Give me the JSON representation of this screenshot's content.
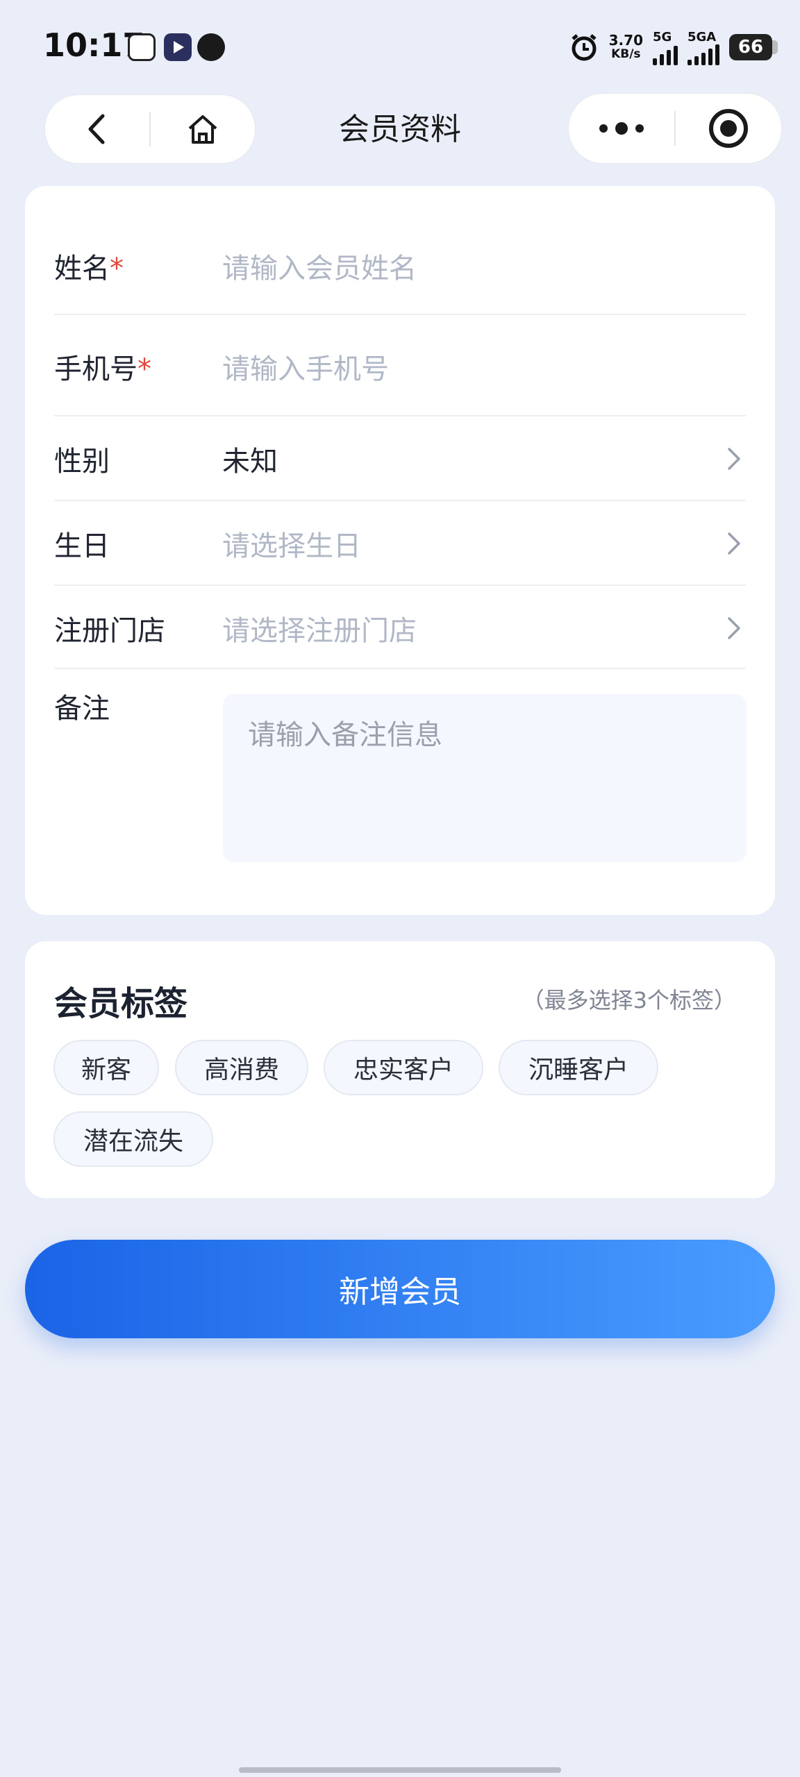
{
  "status_bar": {
    "time": "10:17",
    "net_speed_value": "3.70",
    "net_speed_unit": "KB/s",
    "sim1_label": "5G",
    "sim2_label": "5GA",
    "battery": "66"
  },
  "nav": {
    "title": "会员资料",
    "back_icon": "chevron-left-icon",
    "home_icon": "home-icon",
    "more_icon": "more-dots-icon",
    "target_icon": "target-icon"
  },
  "form": {
    "name": {
      "label": "姓名",
      "required_mark": "*",
      "placeholder": "请输入会员姓名"
    },
    "phone": {
      "label": "手机号",
      "required_mark": "*",
      "placeholder": "请输入手机号"
    },
    "gender": {
      "label": "性别",
      "value": "未知"
    },
    "birthday": {
      "label": "生日",
      "placeholder": "请选择生日"
    },
    "store": {
      "label": "注册门店",
      "placeholder": "请选择注册门店"
    },
    "remark": {
      "label": "备注",
      "placeholder": "请输入备注信息"
    }
  },
  "tags": {
    "title": "会员标签",
    "hint": "（最多选择3个标签）",
    "items": [
      "新客",
      "高消费",
      "忠实客户",
      "沉睡客户",
      "潜在流失"
    ]
  },
  "submit_label": "新增会员",
  "colors": {
    "accent_start": "#1a64e6",
    "accent_end": "#4a9cff",
    "required": "#e0473a"
  }
}
